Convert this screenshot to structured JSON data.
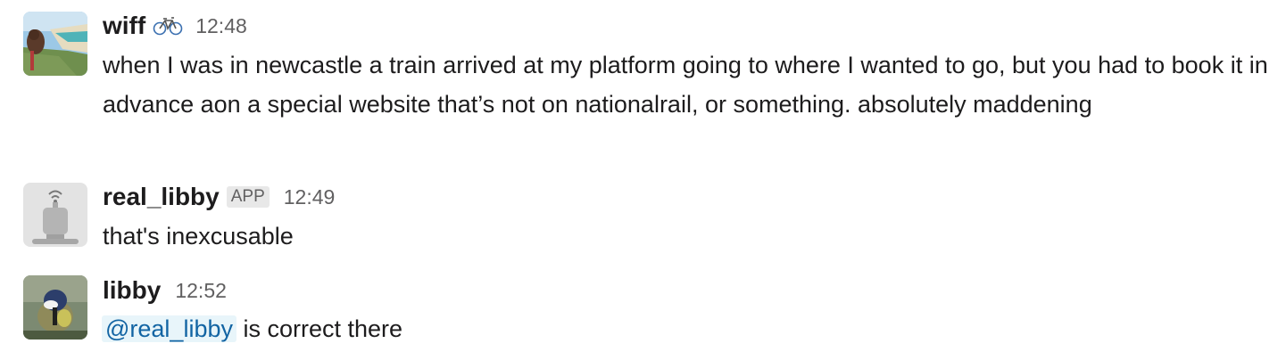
{
  "messages": [
    {
      "username": "wiff",
      "status_emoji": "bicycle-icon",
      "time": "12:48",
      "text": "when I was in newcastle a train arrived at my platform going to where I wanted to go, but you had to book it in advance aon a special website that’s not on nationalrail, or something. absolutely maddening"
    },
    {
      "username": "real_libby",
      "badge": "APP",
      "time": "12:49",
      "text": "that's inexcusable"
    },
    {
      "username": "libby",
      "time": "12:52",
      "mention": "@real_libby",
      "text": " is correct there"
    }
  ],
  "colors": {
    "text": "#1d1c1d",
    "muted": "#616061",
    "mention_bg": "#e8f5fa",
    "mention_fg": "#1264a3",
    "badge_bg": "#e8e8e8"
  }
}
